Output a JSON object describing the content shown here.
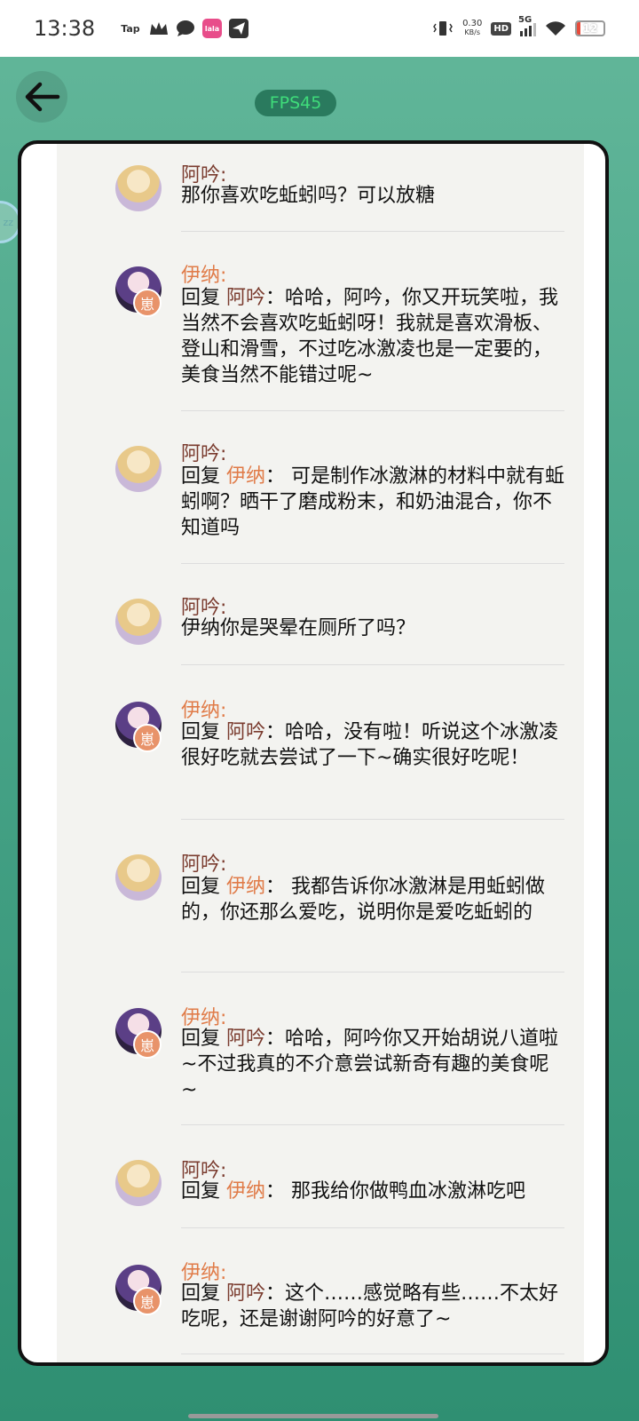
{
  "status_bar": {
    "time": "13:38",
    "app_icons": [
      "Tap",
      "crown-icon",
      "chat-bubble-icon",
      "lala-icon",
      "send-icon"
    ],
    "net_speed_value": "0.30",
    "net_speed_unit": "KB/s",
    "hd_label": "HD",
    "network_label": "5G",
    "battery_level": "12"
  },
  "header": {
    "fps_label": "FPS45"
  },
  "floating_widget": {
    "text": "zz"
  },
  "messages": [
    {
      "sender": "阿吟:",
      "sender_id": "ayin",
      "reply_prefix": "",
      "reply_to": "",
      "text": "那你喜欢吃蚯蚓吗？可以放糖"
    },
    {
      "sender": "伊纳:",
      "sender_id": "yina",
      "reply_prefix": "回复 ",
      "reply_to": "阿吟",
      "text": "：哈哈，阿吟，你又开玩笑啦，我当然不会喜欢吃蚯蚓呀！我就是喜欢滑板、登山和滑雪，不过吃冰激凌也是一定要的，美食当然不能错过呢~",
      "badge": "崽"
    },
    {
      "sender": "阿吟:",
      "sender_id": "ayin",
      "reply_prefix": "回复 ",
      "reply_to": "伊纳",
      "text": "：  可是制作冰激淋的材料中就有蚯蚓啊？晒干了磨成粉末，和奶油混合，你不知道吗"
    },
    {
      "sender": "阿吟:",
      "sender_id": "ayin",
      "reply_prefix": "",
      "reply_to": "",
      "text": "伊纳你是哭晕在厕所了吗？"
    },
    {
      "sender": "伊纳:",
      "sender_id": "yina",
      "reply_prefix": "回复 ",
      "reply_to": "阿吟",
      "text": "：哈哈，没有啦！听说这个冰激凌很好吃就去尝试了一下~确实很好吃呢！",
      "badge": "崽"
    },
    {
      "sender": "阿吟:",
      "sender_id": "ayin",
      "reply_prefix": "回复 ",
      "reply_to": "伊纳",
      "text": "：  我都告诉你冰激淋是用蚯蚓做的，你还那么爱吃，说明你是爱吃蚯蚓的"
    },
    {
      "sender": "伊纳:",
      "sender_id": "yina",
      "reply_prefix": "回复 ",
      "reply_to": "阿吟",
      "text": "：哈哈，阿吟你又开始胡说八道啦~不过我真的不介意尝试新奇有趣的美食呢~",
      "badge": "崽"
    },
    {
      "sender": "阿吟:",
      "sender_id": "ayin",
      "reply_prefix": "回复 ",
      "reply_to": "伊纳",
      "text": "：  那我给你做鸭血冰激淋吃吧"
    },
    {
      "sender": "伊纳:",
      "sender_id": "yina",
      "reply_prefix": "回复 ",
      "reply_to": "阿吟",
      "text": "：这个……感觉略有些……不太好吃呢，还是谢谢阿吟的好意了~",
      "badge": "崽"
    }
  ]
}
